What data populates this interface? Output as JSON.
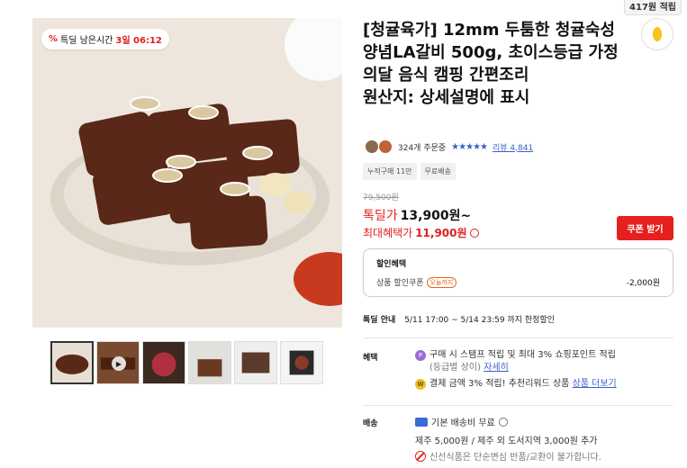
{
  "topbar": {
    "badge": "417원 적립"
  },
  "product": {
    "title": "[청귤육가] 12mm 두툼한 청귤숙성 양념LA갈비 500g, 초이스등급 가정의달 음식 캠핑 간편조리\n원산지: 상세설명에 표시",
    "timer": {
      "label": "특딜 남은시간",
      "remaining": "3일 06:12"
    },
    "orders": "324개 주문중",
    "stars": "★★★★★",
    "review_link": "리뷰 4,841",
    "tags": [
      "누적구매 11만",
      "무료배송"
    ],
    "original_price": "79,500원",
    "price_label": "톡딜가",
    "price": "13,900원~",
    "best_label": "최대혜택가",
    "best_price": "11,900원",
    "coupon_button": "쿠폰 받기"
  },
  "discount": {
    "heading": "할인혜택",
    "item": "상품 할인쿠폰",
    "badge": "오늘까지",
    "amount": "-2,000원"
  },
  "sale_period": {
    "label": "톡딜 안내",
    "text": "5/11 17:00 ~ 5/14 23:59 까지 한정할인"
  },
  "benefits": {
    "label": "혜택",
    "line1": "구매 시 스탬프 적립 및 최대 3% 쇼핑포인트 적립",
    "line1b": "(등급별 상이)",
    "line1_link": "자세히",
    "line2": "결제 금액 3% 적립! 추천리워드 상품",
    "line2_link": "상품 더보기"
  },
  "shipping": {
    "label": "배송",
    "base": "기본 배송비 무료",
    "jeju": "제주 5,000원 / 제주 외 도서지역 3,000원 추가",
    "notice": "신선식품은 단순변심 반품/교환이 불가합니다."
  },
  "colors": {
    "accent": "#e02020",
    "link": "#3a63c8"
  },
  "icons": [
    "percent-icon",
    "heart-icon",
    "play-icon",
    "truck-icon",
    "info-icon",
    "no-return-icon"
  ]
}
